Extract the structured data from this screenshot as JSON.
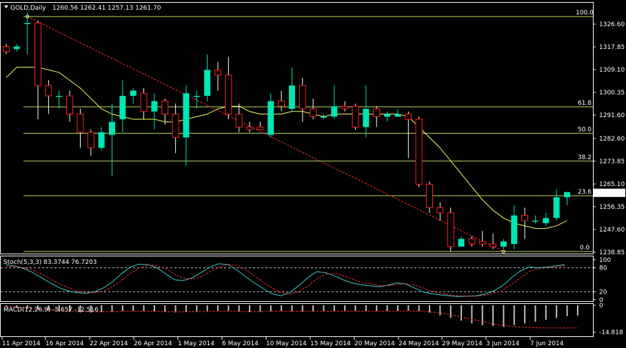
{
  "header": {
    "symbol_tf": "GOLD,Daily",
    "ohlc": "1260.56 1262.41 1257.13 1261.70"
  },
  "indicators": {
    "stoch_label": "Stoch(5,3,3) 83.3744 76.7203",
    "macd_label": "MACD(12,26,9) -5.657 -12.516"
  },
  "colors": {
    "background": "#000000",
    "bull": "#00e6b4",
    "bear": "#ff2020",
    "ma": "#ffff66",
    "fib": "#b8e060",
    "trend": "#ff3030",
    "stoch_main": "#3ad0d0",
    "stoch_signal": "#ff3030",
    "macd_hist": "#c0c0c0",
    "macd_signal": "#ff3030"
  },
  "chart_data": [
    {
      "type": "candlestick",
      "title": "GOLD,Daily",
      "ylim": [
        1238.85,
        1331.0
      ],
      "y_ticks": [
        "1326.60",
        "1317.85",
        "1309.10",
        "1300.35",
        "1291.60",
        "1282.60",
        "1273.85",
        "1265.10",
        "1256.35",
        "1247.60",
        "1238.85"
      ],
      "x_ticks": [
        "11 Apr 2014",
        "16 Apr 2014",
        "22 Apr 2014",
        "26 Apr 2014",
        "1 May 2014",
        "6 May 2014",
        "10 May 2014",
        "15 May 2014",
        "20 May 2014",
        "24 May 2014",
        "29 May 2014",
        "3 Jun 2014",
        "7 Jun 2014"
      ],
      "last_price": "1261.70",
      "fibonacci": [
        {
          "label": "100.0",
          "price": 1329.5
        },
        {
          "label": "61.8",
          "price": 1294.8
        },
        {
          "label": "50.0",
          "price": 1284.6
        },
        {
          "label": "38.2",
          "price": 1273.9
        },
        {
          "label": "23.6",
          "price": 1260.6
        },
        {
          "label": "0.0",
          "price": 1239.1
        }
      ],
      "candles": [
        {
          "o": 1318,
          "h": 1319,
          "l": 1315,
          "c": 1316
        },
        {
          "o": 1317,
          "h": 1319,
          "l": 1316,
          "c": 1318
        },
        {
          "o": 1327,
          "h": 1331,
          "l": 1315,
          "c": 1327
        },
        {
          "o": 1327,
          "h": 1328,
          "l": 1290,
          "c": 1303
        },
        {
          "o": 1303,
          "h": 1305,
          "l": 1292,
          "c": 1299
        },
        {
          "o": 1299,
          "h": 1301,
          "l": 1294,
          "c": 1299
        },
        {
          "o": 1299,
          "h": 1301,
          "l": 1289,
          "c": 1292
        },
        {
          "o": 1292,
          "h": 1294,
          "l": 1279,
          "c": 1285
        },
        {
          "o": 1285,
          "h": 1286,
          "l": 1276,
          "c": 1279
        },
        {
          "o": 1279,
          "h": 1287,
          "l": 1278,
          "c": 1285
        },
        {
          "o": 1284,
          "h": 1296,
          "l": 1268,
          "c": 1289
        },
        {
          "o": 1290,
          "h": 1305,
          "l": 1285,
          "c": 1299
        },
        {
          "o": 1299,
          "h": 1302,
          "l": 1296,
          "c": 1301
        },
        {
          "o": 1300,
          "h": 1302,
          "l": 1290,
          "c": 1293
        },
        {
          "o": 1293,
          "h": 1300,
          "l": 1286,
          "c": 1297
        },
        {
          "o": 1297,
          "h": 1298,
          "l": 1288,
          "c": 1292
        },
        {
          "o": 1292,
          "h": 1296,
          "l": 1277,
          "c": 1283
        },
        {
          "o": 1283,
          "h": 1303,
          "l": 1272,
          "c": 1300
        },
        {
          "o": 1299,
          "h": 1301,
          "l": 1294,
          "c": 1299
        },
        {
          "o": 1299,
          "h": 1315,
          "l": 1297,
          "c": 1309
        },
        {
          "o": 1309,
          "h": 1312,
          "l": 1301,
          "c": 1307
        },
        {
          "o": 1307,
          "h": 1314,
          "l": 1290,
          "c": 1292
        },
        {
          "o": 1292,
          "h": 1296,
          "l": 1285,
          "c": 1287
        },
        {
          "o": 1287,
          "h": 1289,
          "l": 1285,
          "c": 1286
        },
        {
          "o": 1287,
          "h": 1289,
          "l": 1286,
          "c": 1286
        },
        {
          "o": 1284,
          "h": 1300,
          "l": 1283,
          "c": 1297
        },
        {
          "o": 1297,
          "h": 1301,
          "l": 1293,
          "c": 1295
        },
        {
          "o": 1294,
          "h": 1310,
          "l": 1293,
          "c": 1303
        },
        {
          "o": 1303,
          "h": 1306,
          "l": 1289,
          "c": 1294
        },
        {
          "o": 1294,
          "h": 1298,
          "l": 1290,
          "c": 1291
        },
        {
          "o": 1291,
          "h": 1292,
          "l": 1290,
          "c": 1291
        },
        {
          "o": 1291,
          "h": 1303,
          "l": 1290,
          "c": 1295
        },
        {
          "o": 1295,
          "h": 1297,
          "l": 1293,
          "c": 1294
        },
        {
          "o": 1295,
          "h": 1296,
          "l": 1286,
          "c": 1287
        },
        {
          "o": 1287,
          "h": 1303,
          "l": 1283,
          "c": 1294
        },
        {
          "o": 1294,
          "h": 1295,
          "l": 1287,
          "c": 1291
        },
        {
          "o": 1291,
          "h": 1293,
          "l": 1289,
          "c": 1292
        },
        {
          "o": 1291,
          "h": 1294,
          "l": 1291,
          "c": 1292
        },
        {
          "o": 1292,
          "h": 1293,
          "l": 1275,
          "c": 1290
        },
        {
          "o": 1290,
          "h": 1291,
          "l": 1264,
          "c": 1265
        },
        {
          "o": 1265,
          "h": 1266,
          "l": 1254,
          "c": 1256
        },
        {
          "o": 1256,
          "h": 1258,
          "l": 1251,
          "c": 1254
        },
        {
          "o": 1254,
          "h": 1256,
          "l": 1239,
          "c": 1241
        },
        {
          "o": 1241,
          "h": 1245,
          "l": 1241,
          "c": 1244
        },
        {
          "o": 1244,
          "h": 1245,
          "l": 1241,
          "c": 1242
        },
        {
          "o": 1243,
          "h": 1247,
          "l": 1241,
          "c": 1242
        },
        {
          "o": 1242,
          "h": 1246,
          "l": 1240,
          "c": 1241
        },
        {
          "o": 1241,
          "h": 1244,
          "l": 1240,
          "c": 1243
        },
        {
          "o": 1242,
          "h": 1257,
          "l": 1240,
          "c": 1253
        },
        {
          "o": 1253,
          "h": 1256,
          "l": 1244,
          "c": 1251
        },
        {
          "o": 1251,
          "h": 1253,
          "l": 1250,
          "c": 1251
        },
        {
          "o": 1250,
          "h": 1254,
          "l": 1249,
          "c": 1252
        },
        {
          "o": 1252,
          "h": 1263,
          "l": 1251,
          "c": 1260
        },
        {
          "o": 1260,
          "h": 1262,
          "l": 1257,
          "c": 1262
        }
      ],
      "ma_values": [
        1306,
        1310,
        1310,
        1310,
        1309,
        1308,
        1305,
        1302,
        1298,
        1294,
        1292,
        1291,
        1290,
        1290,
        1290,
        1289,
        1289,
        1290,
        1291,
        1292,
        1294,
        1295,
        1295,
        1293,
        1292,
        1292,
        1292,
        1293,
        1293,
        1292,
        1291,
        1292,
        1292,
        1292,
        1292,
        1292,
        1292,
        1292,
        1291,
        1287,
        1283,
        1279,
        1274,
        1269,
        1264,
        1259,
        1255,
        1252,
        1250,
        1249,
        1248,
        1248,
        1249,
        1251
      ],
      "trendline": {
        "from_index": 2,
        "from_price": 1329.5,
        "to_index": 47,
        "to_price": 1239.1
      }
    },
    {
      "type": "line",
      "title": "Stoch(5,3,3) 83.3744 76.7203",
      "ylim": [
        0,
        100
      ],
      "y_ticks": [
        "100",
        "80",
        "20",
        "0"
      ],
      "levels": [
        80,
        20
      ],
      "series": [
        {
          "name": "main",
          "values": [
            88,
            84,
            78,
            68,
            55,
            42,
            30,
            22,
            18,
            16,
            20,
            30,
            45,
            65,
            82,
            89,
            88,
            80,
            65,
            50,
            48,
            55,
            68,
            82,
            90,
            88,
            75,
            58,
            42,
            28,
            15,
            10,
            18,
            35,
            55,
            70,
            68,
            60,
            50,
            42,
            38,
            35,
            33,
            36,
            42,
            40,
            30,
            20,
            15,
            12,
            10,
            8,
            9,
            10,
            14,
            22,
            35,
            55,
            72,
            82,
            80,
            82,
            85,
            88
          ]
        },
        {
          "name": "signal",
          "values": [
            84,
            83,
            80,
            74,
            64,
            52,
            40,
            30,
            22,
            18,
            18,
            22,
            32,
            48,
            66,
            80,
            87,
            86,
            78,
            64,
            54,
            52,
            58,
            70,
            82,
            88,
            86,
            75,
            60,
            44,
            30,
            18,
            14,
            20,
            34,
            52,
            64,
            66,
            60,
            52,
            44,
            40,
            36,
            35,
            38,
            40,
            37,
            30,
            22,
            16,
            12,
            10,
            9,
            9,
            11,
            16,
            24,
            38,
            55,
            70,
            78,
            80,
            82,
            85
          ]
        }
      ]
    },
    {
      "type": "bar",
      "title": "MACD(12,26,9) -5.657 -12.516",
      "ylim": [
        -16,
        1
      ],
      "y_ticks": [
        "0",
        "-14.818"
      ],
      "histogram": [
        -1,
        -1.5,
        -2,
        -2.5,
        -3,
        -3.5,
        -3.8,
        -4,
        -4,
        -3.8,
        -3.6,
        -3.2,
        -3,
        -3.2,
        -3.5,
        -3.8,
        -4,
        -3.8,
        -3.5,
        -3.2,
        -3,
        -3.3,
        -3.6,
        -3.8,
        -3.5,
        -3.3,
        -3.2,
        -3.4,
        -3.6,
        -3.5,
        -3.3,
        -3.2,
        -3,
        -3.2,
        -3.4,
        -3.3,
        -3.2,
        -3.1,
        -3,
        -3.2,
        -4,
        -5.5,
        -7,
        -8.5,
        -10,
        -11,
        -11.5,
        -11.8,
        -11,
        -10,
        -9,
        -8,
        -7,
        -6,
        -5.7
      ],
      "signal": [
        -0.5,
        -1,
        -1.5,
        -2,
        -2.5,
        -3,
        -3.3,
        -3.5,
        -3.6,
        -3.6,
        -3.5,
        -3.4,
        -3.3,
        -3.3,
        -3.4,
        -3.5,
        -3.6,
        -3.6,
        -3.5,
        -3.4,
        -3.3,
        -3.3,
        -3.4,
        -3.5,
        -3.5,
        -3.4,
        -3.3,
        -3.3,
        -3.4,
        -3.4,
        -3.3,
        -3.3,
        -3.2,
        -3.2,
        -3.3,
        -3.3,
        -3.2,
        -3.2,
        -3.2,
        -3.3,
        -3.6,
        -4.2,
        -5.2,
        -6.4,
        -7.7,
        -9,
        -10.2,
        -11.2,
        -11.8,
        -12.2,
        -12.4,
        -12.5,
        -12.5,
        -12.5,
        -12.5
      ]
    }
  ]
}
